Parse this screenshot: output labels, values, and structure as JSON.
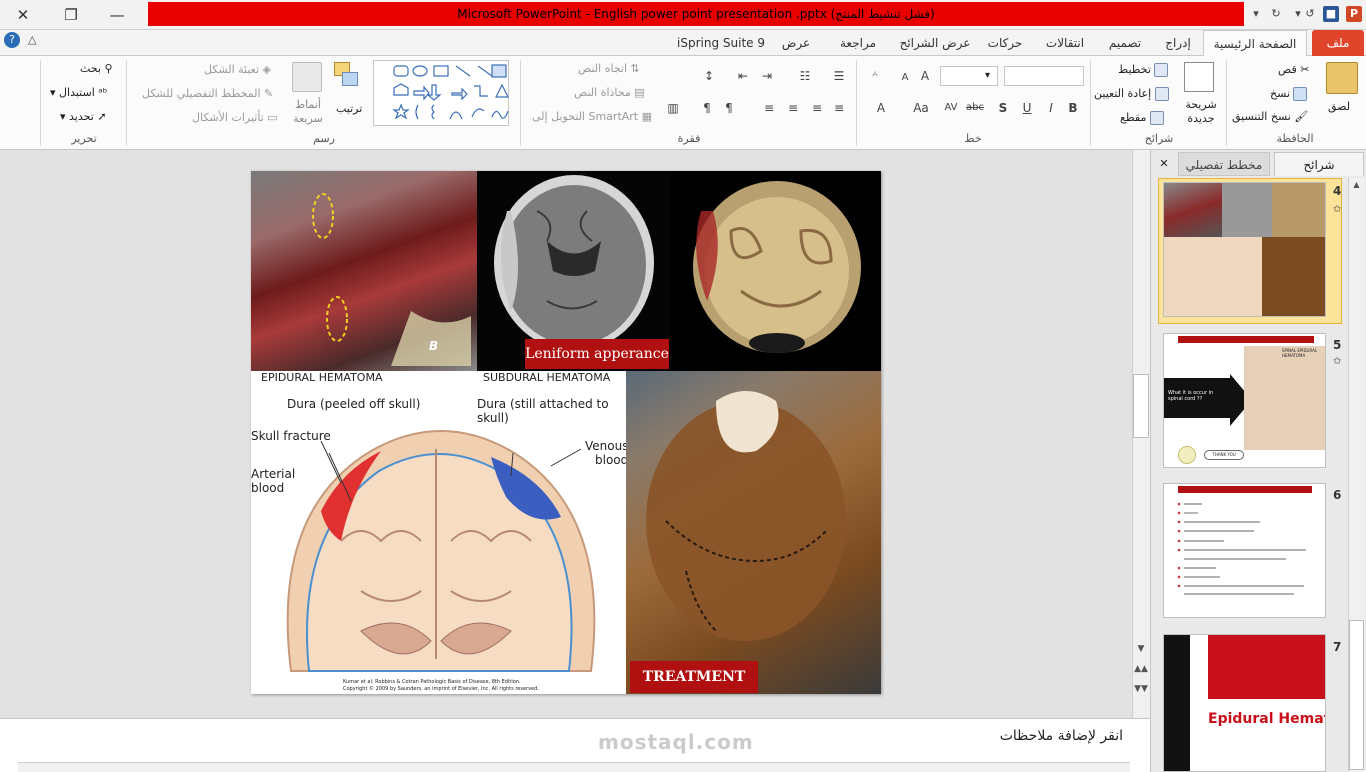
{
  "window": {
    "title": "Microsoft PowerPoint - English power point presentation .pptx (فشل تنشيط المنتج)",
    "close_glyph": "✕",
    "restore_glyph": "❐",
    "minimize_glyph": "—"
  },
  "tabs": [
    {
      "label": "ملف"
    },
    {
      "label": "الصفحة الرئيسية"
    },
    {
      "label": "إدراج"
    },
    {
      "label": "تصميم"
    },
    {
      "label": "انتقالات"
    },
    {
      "label": "حركات"
    },
    {
      "label": "عرض الشرائح"
    },
    {
      "label": "مراجعة"
    },
    {
      "label": "عرض"
    },
    {
      "label": "iSpring Suite 9"
    }
  ],
  "ribbon": {
    "clipboard": {
      "group": "الحافظة",
      "paste": "لصق",
      "cut": "قص",
      "copy": "نسخ",
      "format_painter": "نسخ التنسيق"
    },
    "slides": {
      "group": "شرائح",
      "new_slide": "شريحة جديدة",
      "layout": "تخطيط",
      "reset": "إعادة التعيين",
      "section": "مقطع"
    },
    "font": {
      "group": "خط"
    },
    "paragraph": {
      "group": "فقرة",
      "text_direction": "اتجاه النص",
      "align_text": "محاذاة النص",
      "convert_smartart": "التحويل إلى SmartArt"
    },
    "drawing": {
      "group": "رسم",
      "arrange": "ترتيب",
      "quick_styles": "أنماط سريعة",
      "shape_fill": "تعبئة الشكل",
      "shape_outline": "المخطط التفصيلي للشكل",
      "shape_effects": "تأثيرات الأشكال"
    },
    "editing": {
      "group": "تحرير",
      "find": "بحث",
      "replace": "استبدال",
      "select": "تحديد"
    }
  },
  "slide": {
    "caption_leniform": "Leniform  apperance",
    "caption_treatment": "TREATMENT",
    "label_epidural": "EPIDURAL HEMATOMA",
    "label_subdural": "SUBDURAL HEMATOMA",
    "label_dura_peeled": "Dura (peeled off skull)",
    "label_dura_attached": "Dura (still attached to skull)",
    "label_skull_fracture": "Skull fracture",
    "label_arterial": "Arterial",
    "label_arterial2": "blood",
    "label_venous": "Venous",
    "label_venous2": "blood",
    "label_b": "B",
    "credit1": "Kumar et al: Robbins & Cotran Pathologic Basis of Disease, 8th Edition.",
    "credit2": "Copyright © 2009 by Saunders, an imprint of Elsevier, Inc. All rights reserved."
  },
  "panel": {
    "tab_slides": "شرائح",
    "tab_outline": "مخطط تفصيلي",
    "thumbs": [
      {
        "num": "4"
      },
      {
        "num": "5"
      },
      {
        "num": "6"
      },
      {
        "num": "7",
        "title": "Epidural Hemato"
      }
    ],
    "thumb5_title": "SPINAL EPIDURAL HEMATOMA",
    "thumb5_arrow_text": "What it is occur in spinal cord ??",
    "thumb5_button": "THANK YOU"
  },
  "notes": {
    "placeholder": "انقر لإضافة ملاحظات"
  },
  "watermark": "mostaql.com",
  "colors": {
    "file_tab": "#e0442b",
    "title_bar": "#e80000",
    "caption_bg": "#b01010",
    "selected_thumb": "#f5c542"
  }
}
